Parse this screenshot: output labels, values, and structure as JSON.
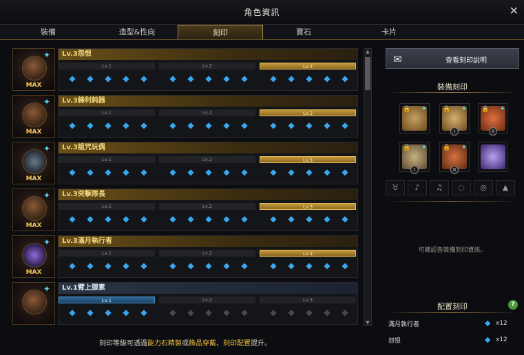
{
  "window": {
    "title": "角色資訊",
    "close_label": "✕"
  },
  "tabs": [
    {
      "label": "裝備",
      "active": false
    },
    {
      "label": "造型&性向",
      "active": false
    },
    {
      "label": "刻印",
      "active": true
    },
    {
      "label": "寶石",
      "active": false
    },
    {
      "label": "卡片",
      "active": false
    }
  ],
  "level_labels": [
    "Lv.1",
    "Lv.2",
    "Lv.3"
  ],
  "engravings": [
    {
      "name": "Lv.3怨恨",
      "max": "MAX",
      "level": 3
    },
    {
      "name": "Lv.3鋒利鈍器",
      "max": "MAX",
      "level": 3
    },
    {
      "name": "Lv.3詛咒玩偶",
      "max": "MAX",
      "level": 3
    },
    {
      "name": "Lv.3突擊隊長",
      "max": "MAX",
      "level": 3
    },
    {
      "name": "Lv.3滿月執行者",
      "max": "MAX",
      "level": 3
    },
    {
      "name": "Lv.1臂上腺素",
      "max": "",
      "level": 1
    }
  ],
  "bottom_note": {
    "part1": "刻印等級可透過",
    "hl1": "能力石精製",
    "part2": "或",
    "hl2": "飾品穿戴",
    "part3": "、",
    "hl3": "刻印配置",
    "part4": "提升。"
  },
  "right_panel": {
    "guide_button": "查看刻印說明",
    "equip_title": "裝備刻印",
    "equip_hint": "可確認各裝備刻印資訊。",
    "preset_title": "配置刻印",
    "help_label": "?",
    "presets": [
      {
        "name": "滿月執行者",
        "count": "x12"
      },
      {
        "name": "怨恨",
        "count": "x12"
      }
    ]
  },
  "colors": {
    "gold": "#c69a3a",
    "blue": "#2e6a98",
    "pip": "#39a8f0",
    "accent": "#5ed6e8"
  },
  "icons": {
    "pip": "diamond-icon",
    "gem": "gem-icon",
    "lock": "lock-icon"
  }
}
